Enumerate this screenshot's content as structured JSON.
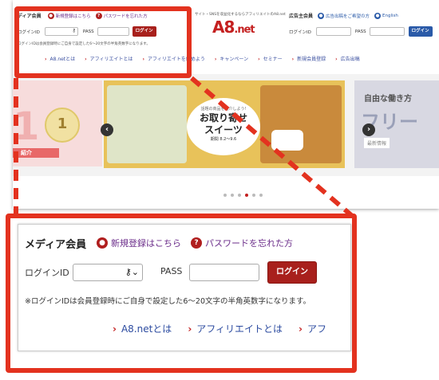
{
  "site": {
    "media_member_title": "ディア会員",
    "register_link": "新規登録はこちら",
    "forgot_link": "パスワードを忘れた方",
    "login_id_label": "ログインID",
    "pass_label": "PASS",
    "login_button": "ログイン",
    "note": "ログインIDは会員登録時にご自身で設定した6〜20文字の半角英数字になります。",
    "tagline": "サイト・SNSを収益化するならアフィリエイトのA8.net",
    "logo": "A8",
    "logo_suffix": ".net",
    "advertiser_title": "広告主会員",
    "advertiser_link": "広告出稿をご希望の方",
    "english_link": "English",
    "adv_login_id_label": "ログインID",
    "adv_pass_label": "PASS",
    "adv_login_button": "ログイン",
    "nav": [
      "A8.netとは",
      "アフィリエイトとは",
      "アフィリエイトを始めよう",
      "キャンペーン",
      "セミナー",
      "新規会員登録",
      "広告出稿"
    ],
    "slides": {
      "left_number": "1",
      "left_badge": "1",
      "left_intro": "紹介",
      "center_small": "話題の商品を紹介しよう!",
      "center_title_1": "お取り寄せ",
      "center_title_2": "スイーツ",
      "center_tag": "期間 8.2〜9.6",
      "right_title": "自由な働き方",
      "right_big": "フリー",
      "right_sub": "最新情報"
    },
    "prev_arrow": "‹",
    "next_arrow": "›"
  },
  "zoom": {
    "title": "メディア会員",
    "register_link": "新規登録はこちら",
    "forgot_link": "パスワードを忘れた方",
    "login_id_label": "ログインID",
    "pass_label": "PASS",
    "login_button": "ログイン",
    "note": "※ログインIDは会員登録時にご自身で設定した6〜20文字の半角英数字になります。",
    "nav": [
      "A8.netとは",
      "アフィリエイトとは",
      "アフ"
    ]
  },
  "colors": {
    "highlight": "#e3321f",
    "brand_red": "#c42020",
    "button": "#a8201c",
    "link": "#2c4ba0"
  }
}
